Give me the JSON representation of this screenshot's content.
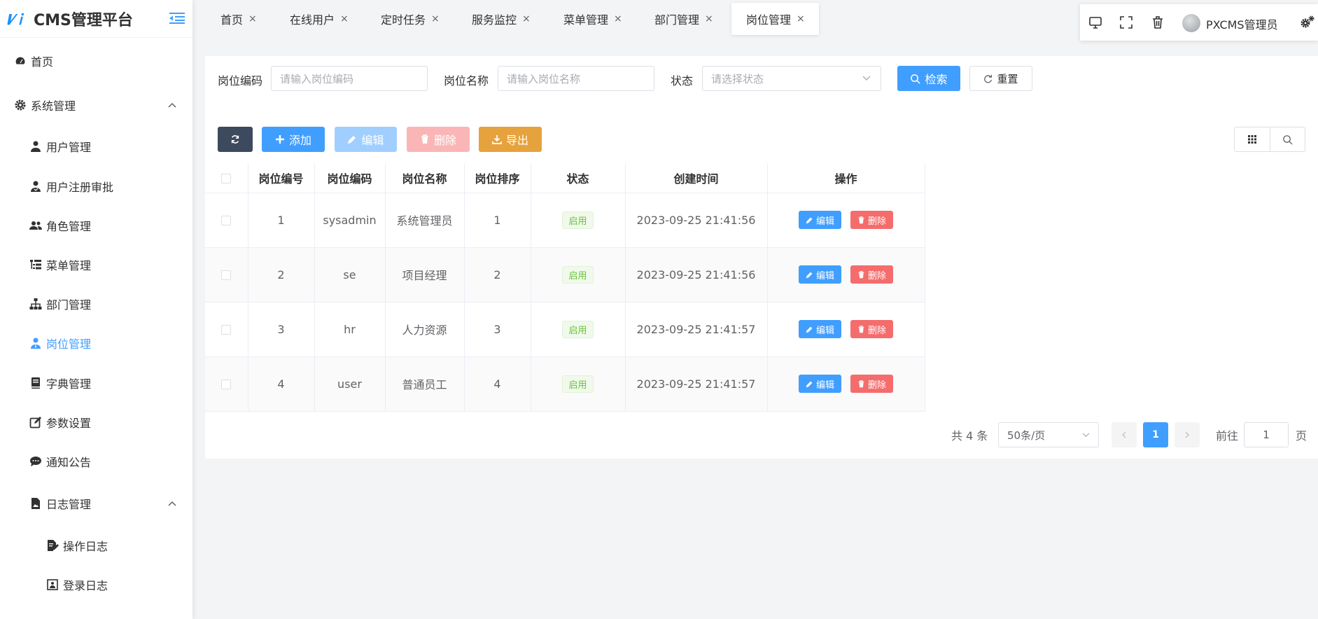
{
  "app": {
    "logo": "Ⅰ⁄ｉ",
    "title": "CMS管理平台"
  },
  "sidebar": {
    "items": [
      {
        "label": "首页",
        "icon": "dashboard-icon"
      },
      {
        "label": "系统管理",
        "icon": "gear-icon"
      },
      {
        "label": "用户管理",
        "icon": "user-icon"
      },
      {
        "label": "用户注册审批",
        "icon": "user-check-icon"
      },
      {
        "label": "角色管理",
        "icon": "users-icon"
      },
      {
        "label": "菜单管理",
        "icon": "list-tree-icon"
      },
      {
        "label": "部门管理",
        "icon": "sitemap-icon"
      },
      {
        "label": "岗位管理",
        "icon": "user-tie-icon"
      },
      {
        "label": "字典管理",
        "icon": "book-icon"
      },
      {
        "label": "参数设置",
        "icon": "edit-icon"
      },
      {
        "label": "通知公告",
        "icon": "comment-icon"
      },
      {
        "label": "日志管理",
        "icon": "file-image-icon"
      },
      {
        "label": "操作日志",
        "icon": "file-edit-icon"
      },
      {
        "label": "登录日志",
        "icon": "login-log-icon"
      }
    ]
  },
  "tabs": [
    {
      "label": "首页",
      "close": "×"
    },
    {
      "label": "在线用户",
      "close": "×"
    },
    {
      "label": "定时任务",
      "close": "×"
    },
    {
      "label": "服务监控",
      "close": "×"
    },
    {
      "label": "菜单管理",
      "close": "×"
    },
    {
      "label": "部门管理",
      "close": "×"
    },
    {
      "label": "岗位管理",
      "close": "×"
    }
  ],
  "header": {
    "username": "PXCMS管理员"
  },
  "search": {
    "code_label": "岗位编码",
    "code_placeholder": "请输入岗位编码",
    "name_label": "岗位名称",
    "name_placeholder": "请输入岗位名称",
    "status_label": "状态",
    "status_placeholder": "请选择状态",
    "search_btn": "检索",
    "reset_btn": "重置"
  },
  "toolbar": {
    "add": "添加",
    "edit": "编辑",
    "delete": "删除",
    "export": "导出"
  },
  "table": {
    "columns": [
      "岗位编号",
      "岗位编码",
      "岗位名称",
      "岗位排序",
      "状态",
      "创建时间",
      "操作"
    ],
    "rows": [
      {
        "id": "1",
        "code": "sysadmin",
        "name": "系统管理员",
        "sort": "1",
        "status": "启用",
        "created": "2023-09-25 21:41:56"
      },
      {
        "id": "2",
        "code": "se",
        "name": "项目经理",
        "sort": "2",
        "status": "启用",
        "created": "2023-09-25 21:41:56"
      },
      {
        "id": "3",
        "code": "hr",
        "name": "人力资源",
        "sort": "3",
        "status": "启用",
        "created": "2023-09-25 21:41:57"
      },
      {
        "id": "4",
        "code": "user",
        "name": "普通员工",
        "sort": "4",
        "status": "启用",
        "created": "2023-09-25 21:41:57"
      }
    ],
    "op_edit": "编辑",
    "op_delete": "删除"
  },
  "pagination": {
    "total": "共 4 条",
    "page_size": "50条/页",
    "current": "1",
    "goto_label": "前往",
    "goto_value": "1",
    "page_suffix": "页"
  },
  "colors": {
    "primary": "#409eff",
    "danger": "#f56c6c",
    "warning": "#e6a23c",
    "success": "#67c23a",
    "dark": "#3d4a5e"
  }
}
